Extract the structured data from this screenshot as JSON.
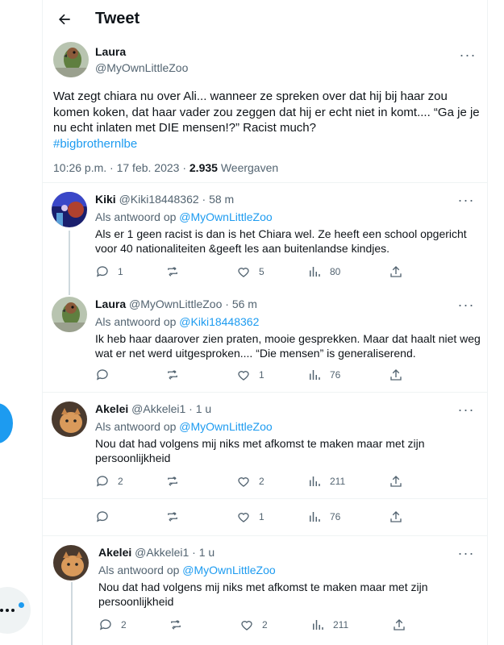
{
  "header": {
    "title": "Tweet"
  },
  "main_tweet": {
    "name": "Laura",
    "handle": "@MyOwnLittleZoo",
    "text": "Wat zegt chiara nu over Ali... wanneer ze spreken over dat hij bij haar zou komen koken, dat haar vader zou zeggen dat hij er echt niet in komt.... “Ga je je nu echt inlaten met DIE mensen!?”  Racist much?",
    "hashtag": "#bigbrothernlbe",
    "time": "10:26 p.m. · 17 feb. 2023 ·",
    "views_count": "2.935",
    "views_label": "Weergaven"
  },
  "replies": [
    {
      "name": "Kiki",
      "handle": "@Kiki18448362 · 58 m",
      "reply_to_prefix": "Als antwoord op",
      "reply_to": "@MyOwnLittleZoo",
      "text": "Als er 1 geen racist is dan is het Chiara wel. Ze heeft een school opgericht voor 40 nationaliteiten &geeft les aan buitenlandse kindjes.",
      "replies": "1",
      "retweets": "",
      "likes": "5",
      "views": "80"
    },
    {
      "name": "Laura",
      "handle": "@MyOwnLittleZoo · 56 m",
      "reply_to_prefix": "Als antwoord op",
      "reply_to": "@Kiki18448362",
      "text": "Ik heb haar daarover zien praten, mooie gesprekken. Maar dat haalt niet weg wat er net werd uitgesproken.... “Die mensen” is generaliserend.",
      "replies": "",
      "retweets": "",
      "likes": "1",
      "views": "76"
    },
    {
      "name": "Akelei",
      "handle": "@Akkelei1 · 1 u",
      "reply_to_prefix": "Als antwoord op",
      "reply_to": "@MyOwnLittleZoo",
      "text": "Nou dat had volgens mij niks met afkomst te maken maar met zijn persoonlijkheid",
      "replies": "2",
      "retweets": "",
      "likes": "2",
      "views": "211"
    }
  ],
  "extra_actions": {
    "replies": "",
    "retweets": "",
    "likes": "1",
    "views": "76"
  },
  "last_reply": {
    "name": "Akelei",
    "handle": "@Akkelei1 · 1 u",
    "reply_to_prefix": "Als antwoord op",
    "reply_to": "@MyOwnLittleZoo",
    "text": "Nou dat had volgens mij niks met afkomst te maken maar met zijn persoonlijkheid",
    "replies": "2",
    "retweets": "",
    "likes": "2",
    "views": "211"
  },
  "colors": {
    "accent": "#1d9bf0",
    "muted": "#536471",
    "text": "#0f1419",
    "border": "#eff3f4"
  }
}
